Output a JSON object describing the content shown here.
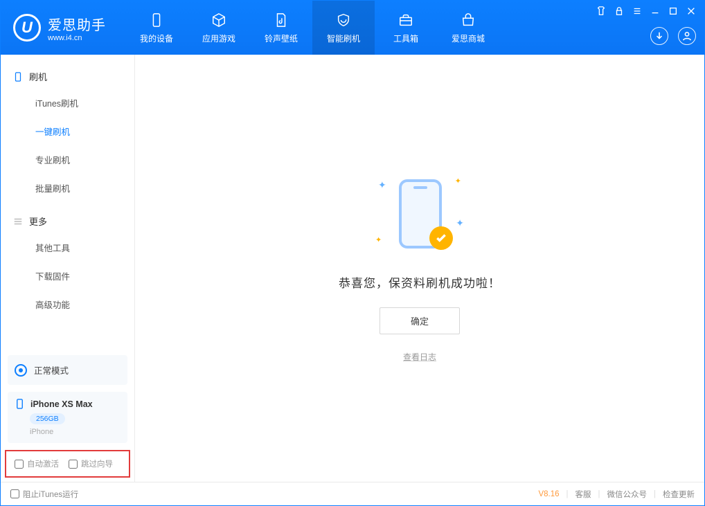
{
  "app": {
    "title": "爱思助手",
    "subtitle": "www.i4.cn"
  },
  "topnav": {
    "device": "我的设备",
    "apps": "应用游戏",
    "ringtone": "铃声壁纸",
    "flash": "智能刷机",
    "tools": "工具箱",
    "store": "爱思商城"
  },
  "sidebar": {
    "group_flash": "刷机",
    "items_flash": {
      "itunes": "iTunes刷机",
      "oneclick": "一键刷机",
      "pro": "专业刷机",
      "batch": "批量刷机"
    },
    "group_more": "更多",
    "items_more": {
      "othertools": "其他工具",
      "download_fw": "下载固件",
      "advanced": "高级功能"
    }
  },
  "mode": {
    "label": "正常模式"
  },
  "device_info": {
    "name": "iPhone XS Max",
    "storage": "256GB",
    "type": "iPhone"
  },
  "checks": {
    "auto_activate": "自动激活",
    "skip_guide": "跳过向导"
  },
  "main": {
    "message": "恭喜您，保资料刷机成功啦！",
    "ok": "确定",
    "view_log": "查看日志"
  },
  "footer": {
    "block_itunes": "阻止iTunes运行",
    "version": "V8.16",
    "support": "客服",
    "wechat": "微信公众号",
    "check_update": "检查更新"
  }
}
